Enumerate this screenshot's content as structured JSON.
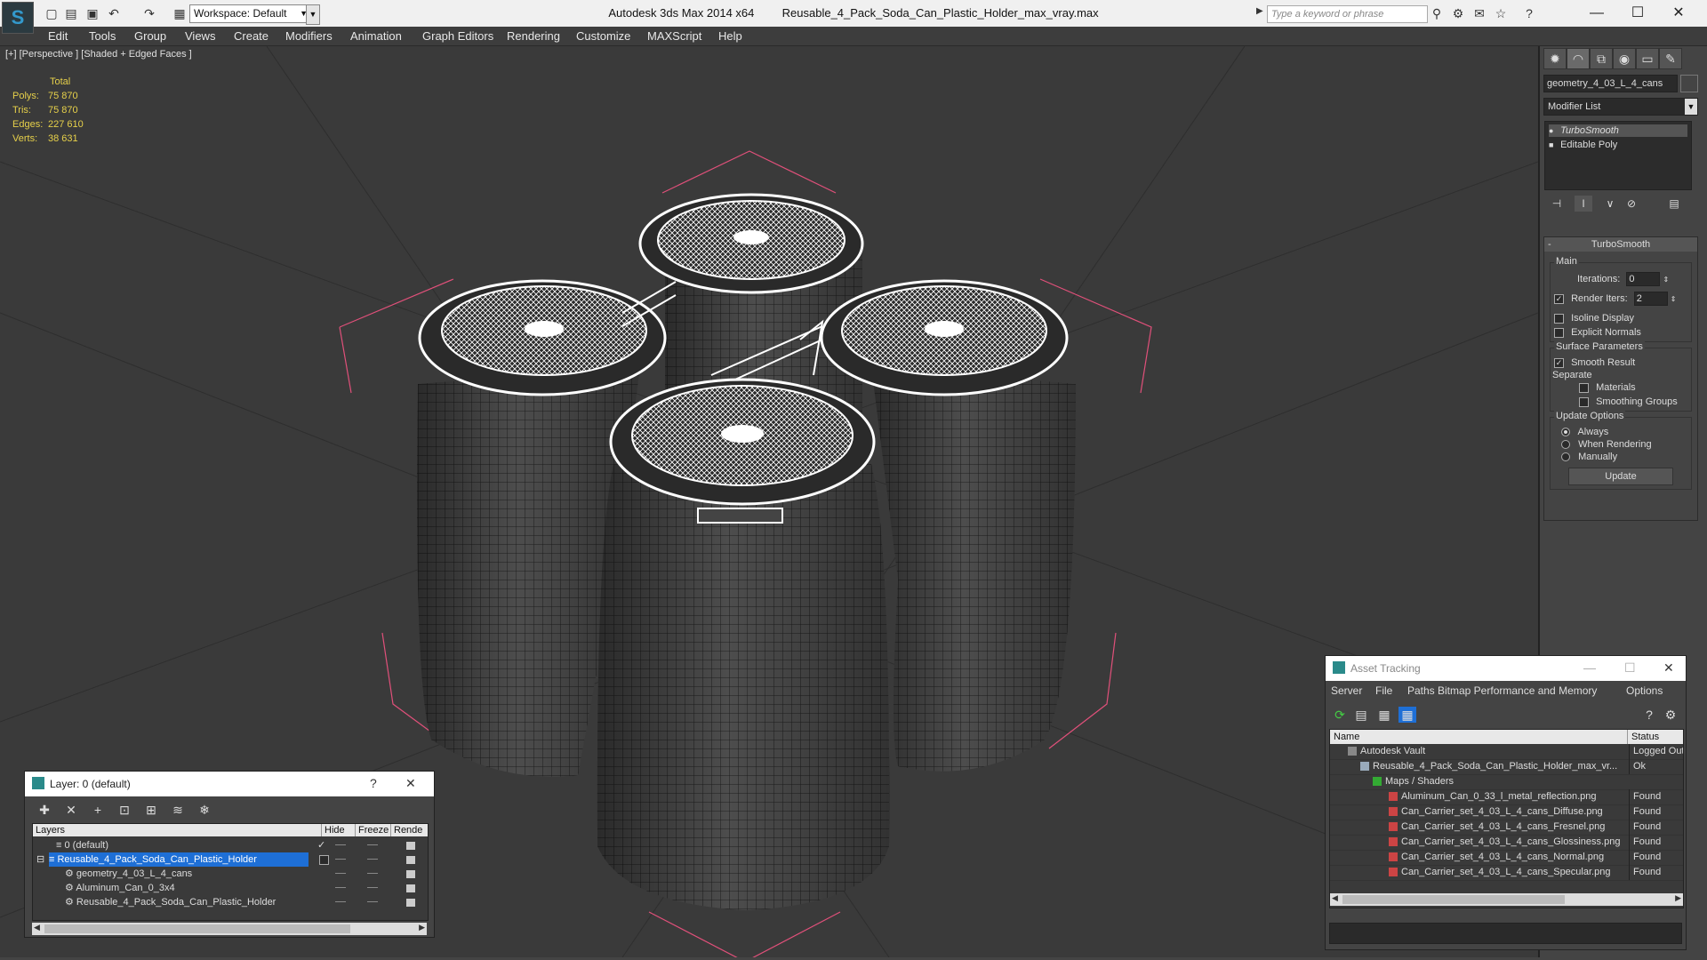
{
  "window": {
    "app_title": "Autodesk 3ds Max  2014 x64",
    "file_title": "Reusable_4_Pack_Soda_Can_Plastic_Holder_max_vray.max",
    "workspace": "Workspace: Default",
    "search_placeholder": "Type a keyword or phrase"
  },
  "menu": [
    "Edit",
    "Tools",
    "Group",
    "Views",
    "Create",
    "Modifiers",
    "Animation",
    "Graph Editors",
    "Rendering",
    "Customize",
    "MAXScript",
    "Help"
  ],
  "viewport": {
    "label": "[+] [Perspective ] [Shaded + Edged Faces ]",
    "stats": {
      "total_label": "Total",
      "rows": [
        {
          "k": "Polys:",
          "v": "75 870"
        },
        {
          "k": "Tris:",
          "v": "75 870"
        },
        {
          "k": "Edges:",
          "v": "227 610"
        },
        {
          "k": "Verts:",
          "v": "38 631"
        }
      ]
    }
  },
  "command_panel": {
    "object_name": "geometry_4_03_L_4_cans",
    "modifier_list": "Modifier List",
    "stack": [
      "TurboSmooth",
      "Editable Poly"
    ],
    "rollout_title": "TurboSmooth",
    "main_label": "Main",
    "iterations_label": "Iterations:",
    "iterations_value": "0",
    "render_iters_label": "Render Iters:",
    "render_iters_value": "2",
    "isoline": "Isoline Display",
    "explicit": "Explicit Normals",
    "surface_label": "Surface Parameters",
    "smooth_result": "Smooth Result",
    "separate": "Separate",
    "materials": "Materials",
    "smoothing_groups": "Smoothing Groups",
    "update_options": "Update Options",
    "always": "Always",
    "when_rendering": "When Rendering",
    "manually": "Manually",
    "update_btn": "Update"
  },
  "layers": {
    "title": "Layer: 0 (default)",
    "help": "?",
    "col_layers": "Layers",
    "col_hide": "Hide",
    "col_freeze": "Freeze",
    "col_render": "Rende",
    "rows": [
      {
        "name": "0 (default)"
      },
      {
        "name": "Reusable_4_Pack_Soda_Can_Plastic_Holder"
      },
      {
        "name": "geometry_4_03_L_4_cans"
      },
      {
        "name": "Aluminum_Can_0_3x4"
      },
      {
        "name": "Reusable_4_Pack_Soda_Can_Plastic_Holder"
      }
    ]
  },
  "asset_tracking": {
    "title": "Asset Tracking",
    "menu": [
      "Server",
      "File",
      "Paths",
      "Bitmap Performance and Memory",
      "Options"
    ],
    "col_name": "Name",
    "col_status": "Status",
    "rows": [
      {
        "name": "Autodesk Vault",
        "status": "Logged Out"
      },
      {
        "name": "Reusable_4_Pack_Soda_Can_Plastic_Holder_max_vr...",
        "status": "Ok"
      },
      {
        "name": "Maps / Shaders",
        "status": ""
      },
      {
        "name": "Aluminum_Can_0_33_l_metal_reflection.png",
        "status": "Found"
      },
      {
        "name": "Can_Carrier_set_4_03_L_4_cans_Diffuse.png",
        "status": "Found"
      },
      {
        "name": "Can_Carrier_set_4_03_L_4_cans_Fresnel.png",
        "status": "Found"
      },
      {
        "name": "Can_Carrier_set_4_03_L_4_cans_Glossiness.png",
        "status": "Found"
      },
      {
        "name": "Can_Carrier_set_4_03_L_4_cans_Normal.png",
        "status": "Found"
      },
      {
        "name": "Can_Carrier_set_4_03_L_4_cans_Specular.png",
        "status": "Found"
      }
    ]
  },
  "colors": {
    "selection_blue": "#1e6fd6",
    "stats_yellow": "#e6d04a",
    "bbox_pink": "#e0507a"
  }
}
